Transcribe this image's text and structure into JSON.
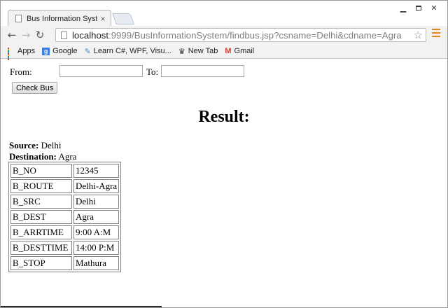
{
  "browser": {
    "tab_title": "Bus Information System",
    "tab_close": "×",
    "url_host": "localhost",
    "url_rest": ":9999/BusInformationSystem/findbus.jsp?csname=Delhi&cdname=Agra",
    "bookmarks": [
      {
        "label": "Apps",
        "icon": "apps-grid-icon"
      },
      {
        "label": "Google",
        "icon": "google-icon"
      },
      {
        "label": "Learn C#, WPF, Visu...",
        "icon": "learn-icon"
      },
      {
        "label": "New Tab",
        "icon": "newtab-icon"
      },
      {
        "label": "Gmail",
        "icon": "gmail-icon"
      }
    ],
    "colors": {
      "menu_accent": "#e6821e",
      "gmail_red": "#d23f31",
      "google_blue": "#3b7de0"
    }
  },
  "form": {
    "from_label": "From:",
    "from_value": "",
    "to_label": "To:",
    "to_value": "",
    "check_button": "Check Bus"
  },
  "result": {
    "heading": "Result:",
    "source_label": "Source:",
    "source_value": "Delhi",
    "destination_label": "Destination:",
    "destination_value": "Agra",
    "rows": [
      {
        "key": "B_NO",
        "value": "12345"
      },
      {
        "key": "B_ROUTE",
        "value": "Delhi-Agra"
      },
      {
        "key": "B_SRC",
        "value": "Delhi"
      },
      {
        "key": "B_DEST",
        "value": "Agra"
      },
      {
        "key": "B_ARRTIME",
        "value": "9:00 A:M"
      },
      {
        "key": "B_DESTTIME",
        "value": "14:00 P:M"
      },
      {
        "key": "B_STOP",
        "value": "Mathura"
      }
    ]
  }
}
